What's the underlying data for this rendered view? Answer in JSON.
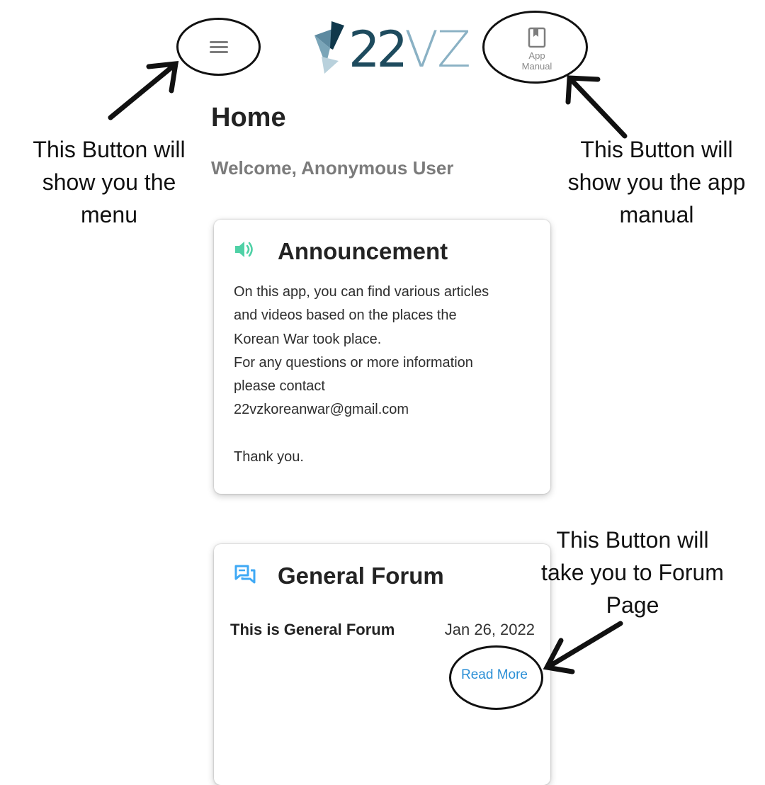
{
  "header": {
    "logo_text_digits": "22",
    "logo_text_letters": "VZ",
    "menu_icon": "hamburger-menu-icon",
    "manual_icon": "bookmark-book-icon",
    "manual_label_line1": "App",
    "manual_label_line2": "Manual"
  },
  "page": {
    "title": "Home",
    "welcome": "Welcome, Anonymous User"
  },
  "announcement": {
    "icon": "speaker-volume-icon",
    "icon_color": "#4fd1a6",
    "title": "Announcement",
    "lines": [
      "On this app, you can find various articles",
      "and videos based on the places the",
      "Korean War took place.",
      "For any questions or more information",
      "please contact",
      "22vzkoreanwar@gmail.com",
      "",
      "Thank you."
    ]
  },
  "forum": {
    "icon": "chat-bubbles-icon",
    "icon_color": "#3fa9f5",
    "title": "General Forum",
    "topic": "This is General Forum",
    "date": "Jan 26, 2022",
    "read_more": "Read More",
    "link_color": "#2b8fd6"
  },
  "annotations": {
    "menu_note": "This Button will show you the menu",
    "manual_note": "This Button will show you the app manual",
    "forum_note": "This Button will take you to Forum Page"
  }
}
